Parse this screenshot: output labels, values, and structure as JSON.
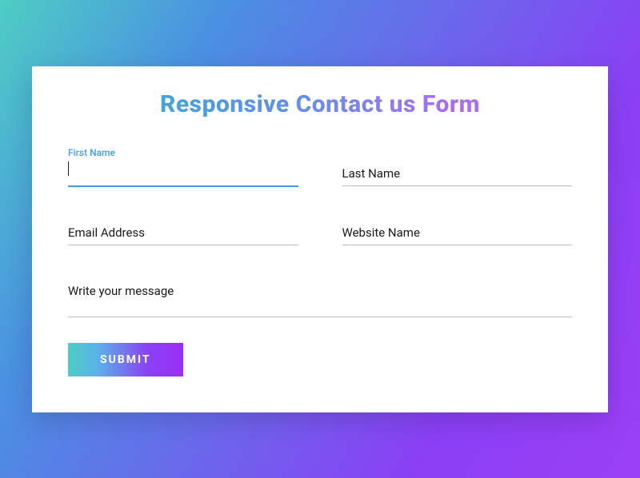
{
  "title": "Responsive Contact us Form",
  "fields": {
    "firstName": {
      "label": "First Name",
      "value": ""
    },
    "lastName": {
      "placeholder": "Last Name",
      "value": ""
    },
    "email": {
      "placeholder": "Email Address",
      "value": ""
    },
    "website": {
      "placeholder": "Website Name",
      "value": ""
    },
    "message": {
      "placeholder": "Write your message",
      "value": ""
    }
  },
  "submit": {
    "label": "SUBMIT"
  }
}
